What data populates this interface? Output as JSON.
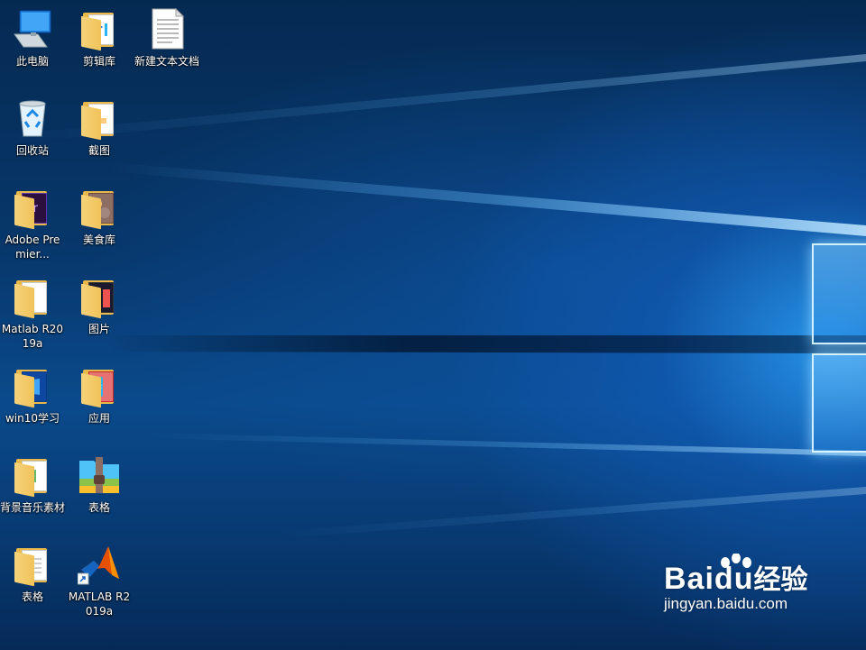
{
  "desktop": {
    "icons": [
      {
        "label": "此电脑",
        "icon": "computer-icon"
      },
      {
        "label": "剪辑库",
        "icon": "folder-icon"
      },
      {
        "label": "新建文本文档",
        "icon": "text-document-icon"
      },
      {
        "label": "回收站",
        "icon": "recycle-bin-icon"
      },
      {
        "label": "截图",
        "icon": "folder-icon"
      },
      {
        "label": "Adobe Premier...",
        "icon": "folder-icon"
      },
      {
        "label": "美食库",
        "icon": "folder-icon"
      },
      {
        "label": "Matlab R2019a",
        "icon": "folder-icon"
      },
      {
        "label": "图片",
        "icon": "folder-icon"
      },
      {
        "label": "win10学习",
        "icon": "folder-icon"
      },
      {
        "label": "应用",
        "icon": "folder-icon"
      },
      {
        "label": "背景音乐素材",
        "icon": "folder-icon"
      },
      {
        "label": "表格",
        "icon": "archive-icon"
      },
      {
        "label": "表格",
        "icon": "folder-icon"
      },
      {
        "label": "MATLAB R2019a",
        "icon": "matlab-shortcut-icon"
      }
    ]
  },
  "watermark": {
    "brand_latin": "Bai",
    "brand_du": "du",
    "brand_cn": "经验",
    "url": "jingyan.baidu.com"
  },
  "colors": {
    "desktop_dark": "#052a52",
    "desktop_light": "#2896eb",
    "folder": "#f0c35a",
    "label_text": "#ffffff"
  }
}
